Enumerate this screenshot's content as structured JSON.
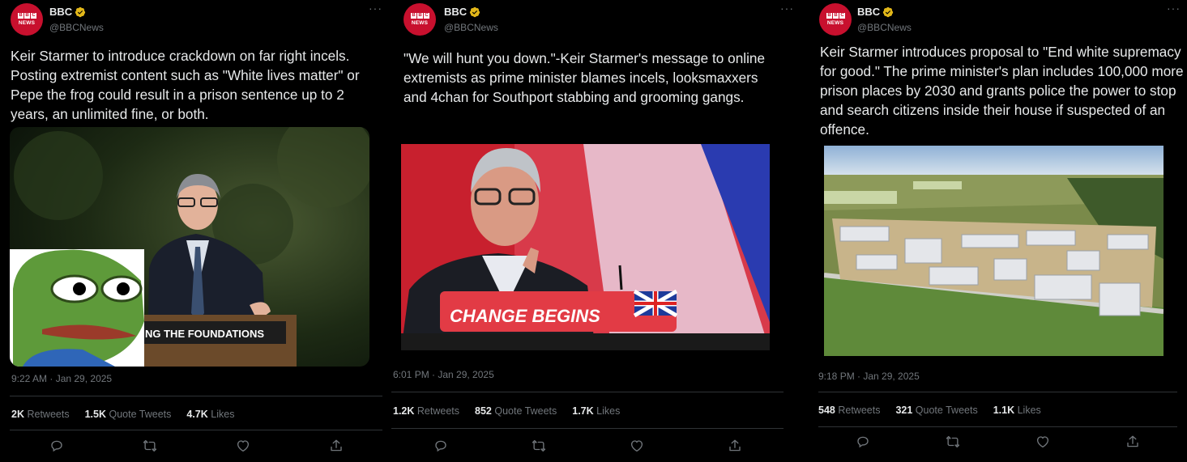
{
  "colors": {
    "background": "#000000",
    "text": "#e7e9ea",
    "muted": "#71767b",
    "divider": "#2f3336",
    "bbc_red": "#c8102e",
    "verified_gold": "#e2b719"
  },
  "tweets": [
    {
      "author": {
        "name": "BBC",
        "handle": "@BBCNews",
        "avatar_text": "NEWS",
        "avatar_letters": [
          "B",
          "B",
          "C"
        ],
        "verified_icon": "gold-check-badge"
      },
      "more_icon": "···",
      "text": "Keir Starmer to introduce crackdown on far right incels. Posting extremist content such as \"White lives matter\" or Pepe the frog could result in a prison sentence up to 2 years, an unlimited fine, or both.",
      "media": {
        "description_icon": "photo",
        "lectern_text": "NG THE FOUNDATIONS"
      },
      "timestamp": "9:22 AM · Jan 29, 2025",
      "stats": {
        "retweets": "2K",
        "retweets_label": "Retweets",
        "quotes": "1.5K",
        "quotes_label": "Quote Tweets",
        "likes": "4.7K",
        "likes_label": "Likes"
      }
    },
    {
      "author": {
        "name": "BBC",
        "handle": "@BBCNews",
        "avatar_text": "NEWS",
        "avatar_letters": [
          "B",
          "B",
          "C"
        ],
        "verified_icon": "gold-check-badge"
      },
      "more_icon": "···",
      "text": "\"We will hunt you down.\"-Keir Starmer's message to online extremists as prime minister blames incels, looksmaxxers and 4chan for Southport stabbing and grooming gangs.",
      "media": {
        "description_icon": "photo",
        "lectern_text": "CHANGE BEGINS"
      },
      "timestamp": "6:01 PM · Jan 29, 2025",
      "stats": {
        "retweets": "1.2K",
        "retweets_label": "Retweets",
        "quotes": "852",
        "quotes_label": "Quote Tweets",
        "likes": "1.7K",
        "likes_label": "Likes"
      }
    },
    {
      "author": {
        "name": "BBC",
        "handle": "@BBCNews",
        "avatar_text": "NEWS",
        "avatar_letters": [
          "B",
          "B",
          "C"
        ],
        "verified_icon": "gold-check-badge"
      },
      "more_icon": "···",
      "text": "Keir Starmer introduces proposal to \"End white supremacy for good.\" The prime minister's plan includes 100,000 more prison places by 2030 and grants police the power to stop and search citizens inside their house if suspected of an offence.",
      "media": {
        "description_icon": "photo"
      },
      "timestamp": "9:18 PM · Jan 29, 2025",
      "stats": {
        "retweets": "548",
        "retweets_label": "Retweets",
        "quotes": "321",
        "quotes_label": "Quote Tweets",
        "likes": "1.1K",
        "likes_label": "Likes"
      }
    }
  ]
}
